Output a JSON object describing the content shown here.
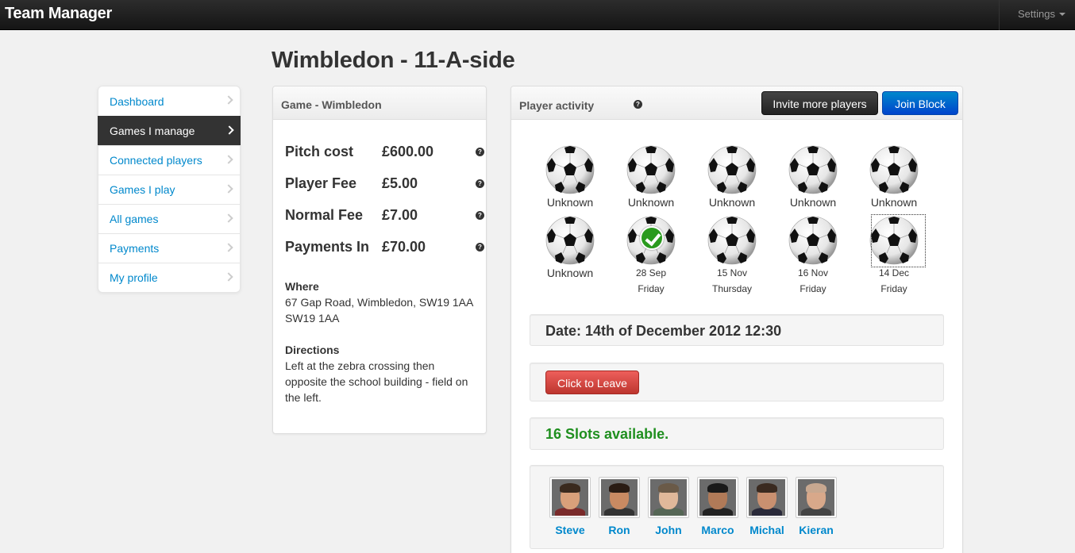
{
  "navbar": {
    "brand": "Team Manager",
    "settings_label": "Settings"
  },
  "page_title": "Wimbledon - 11-A-side",
  "sidebar": {
    "items": [
      {
        "label": "Dashboard",
        "active": false
      },
      {
        "label": "Games I manage",
        "active": true
      },
      {
        "label": "Connected players",
        "active": false
      },
      {
        "label": "Games I play",
        "active": false
      },
      {
        "label": "All games",
        "active": false
      },
      {
        "label": "Payments",
        "active": false
      },
      {
        "label": "My profile",
        "active": false
      }
    ]
  },
  "game_panel": {
    "title": "Game - Wimbledon",
    "fees": [
      {
        "label": "Pitch cost",
        "value": "£600.00"
      },
      {
        "label": "Player Fee",
        "value": "£5.00"
      },
      {
        "label": "Normal Fee",
        "value": "£7.00"
      },
      {
        "label": "Payments In",
        "value": "£70.00"
      }
    ],
    "help_glyph": "?",
    "where_heading": "Where",
    "where_line1": "67 Gap Road, Wimbledon, SW19 1AA",
    "where_line2": "SW19 1AA",
    "directions_heading": "Directions",
    "directions_text": "Left at the zebra crossing then opposite the school building - field on the left."
  },
  "activity_panel": {
    "title": "Player activity",
    "invite_button": "Invite more players",
    "join_button": "Join Block",
    "balls": [
      {
        "line1": "Unknown",
        "line2": "",
        "checked": false,
        "selected": false
      },
      {
        "line1": "Unknown",
        "line2": "",
        "checked": false,
        "selected": false
      },
      {
        "line1": "Unknown",
        "line2": "",
        "checked": false,
        "selected": false
      },
      {
        "line1": "Unknown",
        "line2": "",
        "checked": false,
        "selected": false
      },
      {
        "line1": "Unknown",
        "line2": "",
        "checked": false,
        "selected": false
      },
      {
        "line1": "Unknown",
        "line2": "",
        "checked": false,
        "selected": false
      },
      {
        "line1": "28 Sep",
        "line2": "Friday",
        "checked": true,
        "selected": false
      },
      {
        "line1": "15 Nov",
        "line2": "Thursday",
        "checked": false,
        "selected": false
      },
      {
        "line1": "16 Nov",
        "line2": "Friday",
        "checked": false,
        "selected": false
      },
      {
        "line1": "14 Dec",
        "line2": "Friday",
        "checked": false,
        "selected": true
      }
    ],
    "date_text": "Date: 14th of December 2012 12:30",
    "leave_button": "Click to Leave",
    "slots_text": "16 Slots available.",
    "slots_color": "#1f8f1f",
    "players": [
      {
        "name": "Steve",
        "skin": "#d9a07a",
        "hair": "#3a2a1e",
        "shirt": "#7a2a2a"
      },
      {
        "name": "Ron",
        "skin": "#c98a62",
        "hair": "#2a1c14",
        "shirt": "#333333"
      },
      {
        "name": "John",
        "skin": "#e0b89a",
        "hair": "#6a5a48",
        "shirt": "#556655"
      },
      {
        "name": "Marco",
        "skin": "#b07a58",
        "hair": "#1a1a1a",
        "shirt": "#222222"
      },
      {
        "name": "Michal",
        "skin": "#c99070",
        "hair": "#3a2a20",
        "shirt": "#2a2a3a"
      },
      {
        "name": "Kieran",
        "skin": "#d8a88a",
        "hair": "#c8a890",
        "shirt": "#444444"
      }
    ]
  },
  "colors": {
    "link": "#0088cc",
    "primary": "#0044cc",
    "danger": "#bd362f",
    "success": "#1f8f1f"
  }
}
